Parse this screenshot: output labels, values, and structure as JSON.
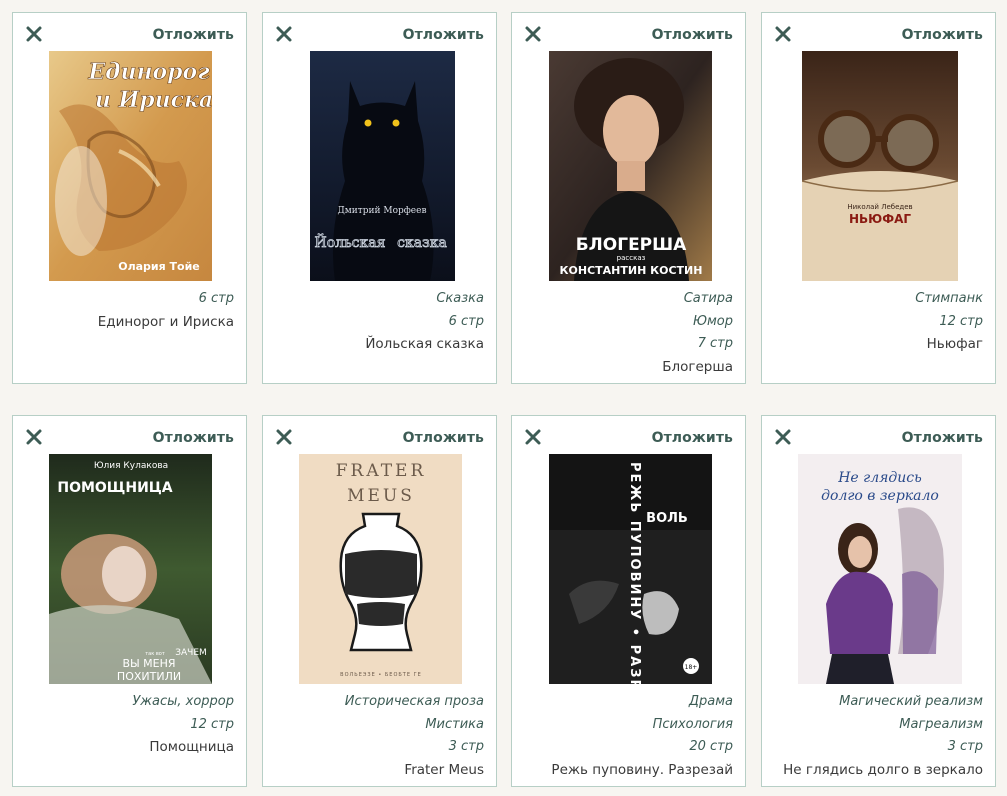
{
  "labels": {
    "postpone": "Отложить"
  },
  "books": [
    {
      "genres": [],
      "pages": "6 стр",
      "title": "Единорог и Ириска",
      "cover_text": {
        "title_line1": "Единорог",
        "title_line2": "и Ириска",
        "author": "Олария Тойе"
      }
    },
    {
      "genres": [
        "Сказка"
      ],
      "pages": "6 стр",
      "title": "Йольская сказка",
      "cover_text": {
        "author": "Дмитрий Морфеев",
        "title_left": "Йольская",
        "title_right": "сказка"
      }
    },
    {
      "genres": [
        "Сатира",
        "Юмор"
      ],
      "pages": "7 стр",
      "title": "Блогерша",
      "cover_text": {
        "title": "БЛОГЕРША",
        "subtitle": "рассказ",
        "author": "КОНСТАНТИН КОСТИН"
      }
    },
    {
      "genres": [
        "Стимпанк"
      ],
      "pages": "12 стр",
      "title": "Ньюфаг",
      "cover_text": {
        "author": "Николай Лебедев",
        "title": "НЬЮФАГ"
      }
    },
    {
      "genres": [
        "Ужасы, хоррор"
      ],
      "pages": "12 стр",
      "title": "Помощница",
      "cover_text": {
        "author": "Юлия Кулакова",
        "title": "ПОМОЩНИЦА",
        "tagline_small": "так вот",
        "tagline_word": "ЗАЧЕМ",
        "tagline_l1": "ВЫ МЕНЯ",
        "tagline_l2": "ПОХИТИЛИ"
      }
    },
    {
      "genres": [
        "Историческая проза",
        "Мистика"
      ],
      "pages": "3 стр",
      "title": "Frater Meus",
      "cover_text": {
        "title_l1": "FRATER",
        "title_l2": "MEUS",
        "author": "ВОЛЬЕЭЗЕ • БЕОБТЕ ГЕ"
      }
    },
    {
      "genres": [
        "Драма",
        "Психология"
      ],
      "pages": "20 стр",
      "title": "Режь пуповину. Разрезай",
      "cover_text": {
        "vertical": "РЕЖЬ ПУПОВИНУ • РАЗРЕЗАЙ",
        "author": "ВОЛЬ",
        "age": "18+"
      }
    },
    {
      "genres": [
        "Магический реализм",
        "Магреализм"
      ],
      "pages": "3 стр",
      "title": "Не глядись долго в зеркало",
      "cover_text": {
        "title_l1": "Не глядись",
        "title_l2": "долго в зеркало"
      }
    }
  ],
  "colors": {
    "accent": "#3d5c55",
    "border": "#b7cfc6",
    "background": "#f7f5f1"
  }
}
